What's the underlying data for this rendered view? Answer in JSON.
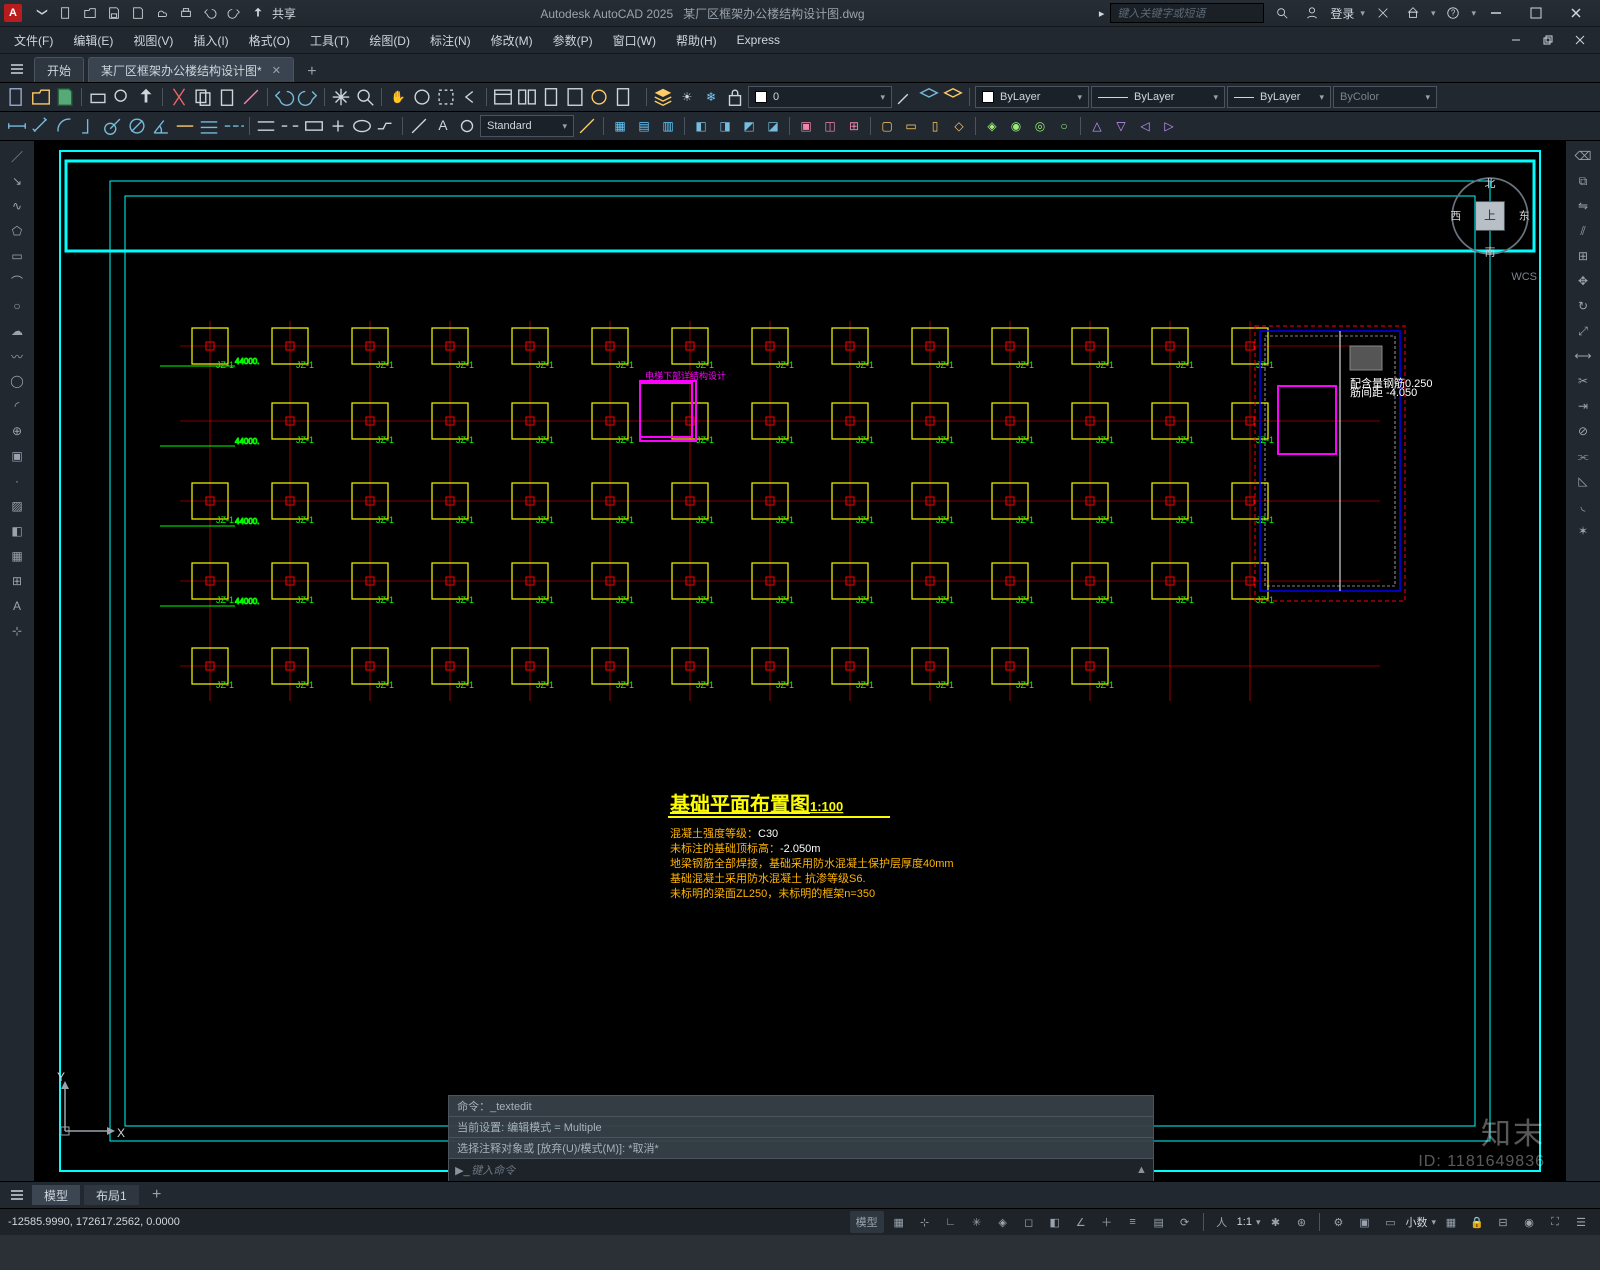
{
  "app": {
    "title": "Autodesk AutoCAD 2025",
    "doc": "某厂区框架办公楼结构设计图.dwg",
    "share": "共享",
    "search_placeholder": "键入关键字或短语",
    "login": "登录"
  },
  "menus": [
    "文件(F)",
    "编辑(E)",
    "视图(V)",
    "插入(I)",
    "格式(O)",
    "工具(T)",
    "绘图(D)",
    "标注(N)",
    "修改(M)",
    "参数(P)",
    "窗口(W)",
    "帮助(H)",
    "Express"
  ],
  "file_tabs": {
    "start": "开始",
    "active": "某厂区框架办公楼结构设计图*",
    "add": "+"
  },
  "layer_controls": {
    "current_layer": "0",
    "linetype": "ByLayer",
    "lineweight": "ByLayer",
    "color": "ByColor",
    "text_style": "Standard"
  },
  "drawing": {
    "view_title": "基础平面布置图",
    "view_scale": "1:100",
    "concrete_grade_label": "混凝土强度等级：",
    "concrete_grade_value": "C30",
    "elev_label": "未标注的基础顶标高：",
    "elev_value": "-2.050m",
    "rebar_note": "地梁钢筋全部焊接，基础采用防水混凝土保护层厚度40mm",
    "seismic_note": "基础混凝土采用防水混凝土  抗渗等级S6.",
    "beam_note": "未标明的梁面ZL250，未标明的框架n=350",
    "shaft_note": "电梯下部详结构设计",
    "compass": {
      "n": "北",
      "e": "东",
      "s": "南",
      "w": "西",
      "top": "上"
    },
    "wcs": "WCS",
    "foundation_label": "JZ-1",
    "dim_labels": [
      "44000.",
      "44000.",
      "44000.",
      "44000."
    ]
  },
  "command": {
    "hist1": "命令：_textedit",
    "hist2": "当前设置: 编辑模式 = Multiple",
    "hist3": "选择注释对象或 [放弃(U)/模式(M)]: *取消*",
    "prompt_placeholder": "键入命令"
  },
  "model_tabs": {
    "model": "模型",
    "layout1": "布局1",
    "add": "+"
  },
  "status": {
    "coords": "-12585.9990, 172617.2562, 0.0000",
    "model_btn": "模型",
    "units": "小数",
    "scale": "1:1"
  },
  "watermark": {
    "brand": "知末",
    "id": "ID: 1181649836"
  },
  "icons": {
    "qat": [
      "new-icon",
      "open-icon",
      "save-icon",
      "saveas-icon",
      "publish-icon",
      "plot-icon",
      "undo-icon",
      "redo-icon"
    ],
    "title_right": [
      "search-icon",
      "user-icon",
      "down-icon",
      "basket-icon",
      "help-icon"
    ],
    "winctrl": [
      "min-icon",
      "max-icon",
      "close-icon"
    ]
  }
}
